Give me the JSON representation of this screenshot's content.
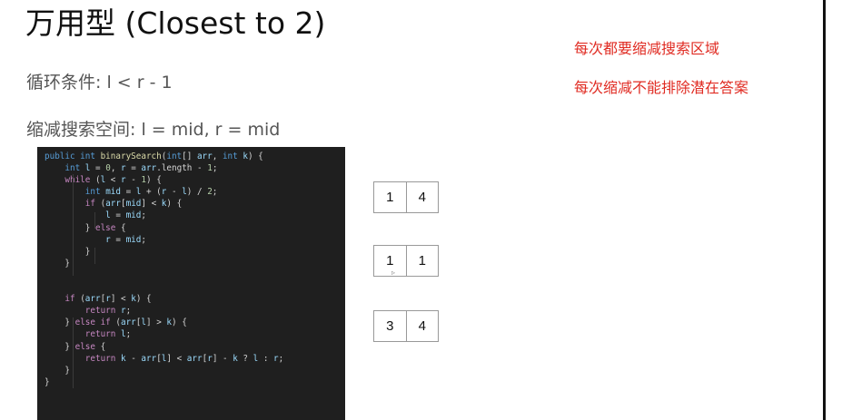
{
  "slide": {
    "title": "万用型 (Closest to 2)",
    "loop_condition": "循环条件: l < r - 1",
    "shrink_space": "缩减搜索空间: l = mid, r = mid",
    "notes": [
      "每次都要缩减搜索区域",
      "每次缩减不能排除潜在答案"
    ],
    "accent_color": "#e02b22"
  },
  "code": {
    "lines": [
      [
        {
          "t": "public int ",
          "c": "kw"
        },
        {
          "t": "binarySearch",
          "c": "fn"
        },
        {
          "t": "(",
          "c": ""
        },
        {
          "t": "int",
          "c": "ty"
        },
        {
          "t": "[] ",
          "c": ""
        },
        {
          "t": "arr",
          "c": "var"
        },
        {
          "t": ", ",
          "c": ""
        },
        {
          "t": "int",
          "c": "ty"
        },
        {
          "t": " ",
          "c": ""
        },
        {
          "t": "k",
          "c": "var"
        },
        {
          "t": ") {",
          "c": ""
        }
      ],
      [
        {
          "t": "    ",
          "c": ""
        },
        {
          "t": "int",
          "c": "ty"
        },
        {
          "t": " ",
          "c": ""
        },
        {
          "t": "l",
          "c": "var"
        },
        {
          "t": " = ",
          "c": ""
        },
        {
          "t": "0",
          "c": "num"
        },
        {
          "t": ", ",
          "c": ""
        },
        {
          "t": "r",
          "c": "var"
        },
        {
          "t": " = ",
          "c": ""
        },
        {
          "t": "arr",
          "c": "var"
        },
        {
          "t": ".length - ",
          "c": ""
        },
        {
          "t": "1",
          "c": "num"
        },
        {
          "t": ";",
          "c": ""
        }
      ],
      [
        {
          "t": "    ",
          "c": ""
        },
        {
          "t": "while",
          "c": "ctl"
        },
        {
          "t": " (",
          "c": ""
        },
        {
          "t": "l",
          "c": "var"
        },
        {
          "t": " < ",
          "c": ""
        },
        {
          "t": "r",
          "c": "var"
        },
        {
          "t": " - ",
          "c": ""
        },
        {
          "t": "1",
          "c": "num"
        },
        {
          "t": ") {",
          "c": ""
        }
      ],
      [
        {
          "t": "        ",
          "c": ""
        },
        {
          "t": "int",
          "c": "ty"
        },
        {
          "t": " ",
          "c": ""
        },
        {
          "t": "mid",
          "c": "var"
        },
        {
          "t": " = ",
          "c": ""
        },
        {
          "t": "l",
          "c": "var"
        },
        {
          "t": " + (",
          "c": ""
        },
        {
          "t": "r",
          "c": "var"
        },
        {
          "t": " - ",
          "c": ""
        },
        {
          "t": "l",
          "c": "var"
        },
        {
          "t": ") / ",
          "c": ""
        },
        {
          "t": "2",
          "c": "num"
        },
        {
          "t": ";",
          "c": ""
        }
      ],
      [
        {
          "t": "        ",
          "c": ""
        },
        {
          "t": "if",
          "c": "ctl"
        },
        {
          "t": " (",
          "c": ""
        },
        {
          "t": "arr",
          "c": "var"
        },
        {
          "t": "[",
          "c": ""
        },
        {
          "t": "mid",
          "c": "var"
        },
        {
          "t": "] < ",
          "c": ""
        },
        {
          "t": "k",
          "c": "var"
        },
        {
          "t": ") {",
          "c": ""
        }
      ],
      [
        {
          "t": "            ",
          "c": ""
        },
        {
          "t": "l",
          "c": "var"
        },
        {
          "t": " = ",
          "c": ""
        },
        {
          "t": "mid",
          "c": "var"
        },
        {
          "t": ";",
          "c": ""
        }
      ],
      [
        {
          "t": "        } ",
          "c": ""
        },
        {
          "t": "else",
          "c": "ctl"
        },
        {
          "t": " {",
          "c": ""
        }
      ],
      [
        {
          "t": "            ",
          "c": ""
        },
        {
          "t": "r",
          "c": "var"
        },
        {
          "t": " = ",
          "c": ""
        },
        {
          "t": "mid",
          "c": "var"
        },
        {
          "t": ";",
          "c": ""
        }
      ],
      [
        {
          "t": "        }",
          "c": ""
        }
      ],
      [
        {
          "t": "    }",
          "c": ""
        }
      ],
      [
        {
          "t": "",
          "c": ""
        }
      ],
      [
        {
          "t": "",
          "c": ""
        }
      ],
      [
        {
          "t": "    ",
          "c": ""
        },
        {
          "t": "if",
          "c": "ctl"
        },
        {
          "t": " (",
          "c": ""
        },
        {
          "t": "arr",
          "c": "var"
        },
        {
          "t": "[",
          "c": ""
        },
        {
          "t": "r",
          "c": "var"
        },
        {
          "t": "] < ",
          "c": ""
        },
        {
          "t": "k",
          "c": "var"
        },
        {
          "t": ") {",
          "c": ""
        }
      ],
      [
        {
          "t": "        ",
          "c": ""
        },
        {
          "t": "return",
          "c": "ctl"
        },
        {
          "t": " ",
          "c": ""
        },
        {
          "t": "r",
          "c": "var"
        },
        {
          "t": ";",
          "c": ""
        }
      ],
      [
        {
          "t": "    } ",
          "c": ""
        },
        {
          "t": "else if",
          "c": "ctl"
        },
        {
          "t": " (",
          "c": ""
        },
        {
          "t": "arr",
          "c": "var"
        },
        {
          "t": "[",
          "c": ""
        },
        {
          "t": "l",
          "c": "var"
        },
        {
          "t": "] > ",
          "c": ""
        },
        {
          "t": "k",
          "c": "var"
        },
        {
          "t": ") {",
          "c": ""
        }
      ],
      [
        {
          "t": "        ",
          "c": ""
        },
        {
          "t": "return",
          "c": "ctl"
        },
        {
          "t": " ",
          "c": ""
        },
        {
          "t": "l",
          "c": "var"
        },
        {
          "t": ";",
          "c": ""
        }
      ],
      [
        {
          "t": "    } ",
          "c": ""
        },
        {
          "t": "else",
          "c": "ctl"
        },
        {
          "t": " {",
          "c": ""
        }
      ],
      [
        {
          "t": "        ",
          "c": ""
        },
        {
          "t": "return",
          "c": "ctl"
        },
        {
          "t": " ",
          "c": ""
        },
        {
          "t": "k",
          "c": "var"
        },
        {
          "t": " - ",
          "c": ""
        },
        {
          "t": "arr",
          "c": "var"
        },
        {
          "t": "[",
          "c": ""
        },
        {
          "t": "l",
          "c": "var"
        },
        {
          "t": "] < ",
          "c": ""
        },
        {
          "t": "arr",
          "c": "var"
        },
        {
          "t": "[",
          "c": ""
        },
        {
          "t": "r",
          "c": "var"
        },
        {
          "t": "] - ",
          "c": ""
        },
        {
          "t": "k",
          "c": "var"
        },
        {
          "t": " ? ",
          "c": ""
        },
        {
          "t": "l",
          "c": "var"
        },
        {
          "t": " : ",
          "c": ""
        },
        {
          "t": "r",
          "c": "var"
        },
        {
          "t": ";",
          "c": ""
        }
      ],
      [
        {
          "t": "    }",
          "c": ""
        }
      ],
      [
        {
          "t": "}",
          "c": ""
        }
      ]
    ]
  },
  "pairs": [
    {
      "left": "1",
      "right": "4"
    },
    {
      "left": "1",
      "right": "1"
    },
    {
      "left": "3",
      "right": "4"
    }
  ]
}
